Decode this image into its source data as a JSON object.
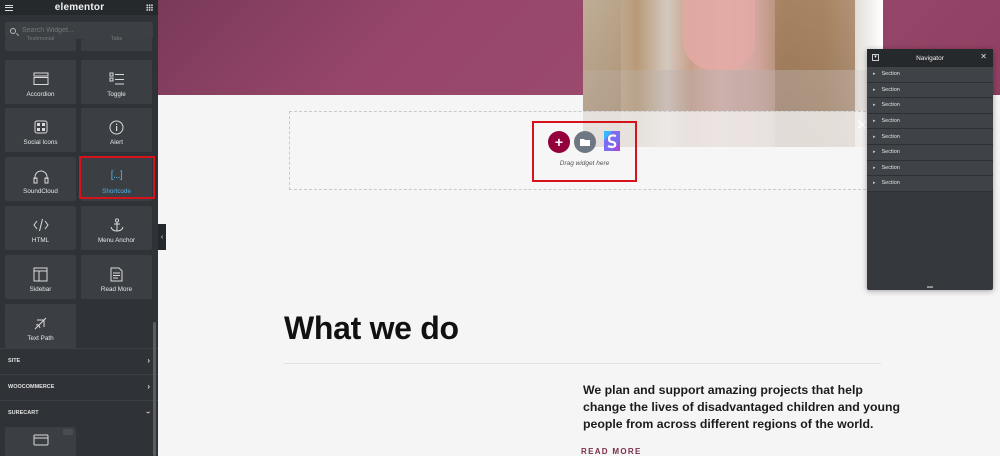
{
  "sidebar": {
    "logo": "elementor",
    "search_placeholder": "Search Widget...",
    "partial_tiles": [
      "Testimonial",
      "Tabs"
    ],
    "widgets": [
      {
        "label": "Accordion",
        "icon": "accordion-icon"
      },
      {
        "label": "Toggle",
        "icon": "toggle-icon"
      },
      {
        "label": "Social Icons",
        "icon": "social-icons-icon"
      },
      {
        "label": "Alert",
        "icon": "alert-icon"
      },
      {
        "label": "SoundCloud",
        "icon": "headphones-icon"
      },
      {
        "label": "Shortcode",
        "icon": "shortcode-icon",
        "glyph": "[...]",
        "highlighted": true
      },
      {
        "label": "HTML",
        "icon": "code-icon"
      },
      {
        "label": "Menu Anchor",
        "icon": "anchor-icon"
      },
      {
        "label": "Sidebar",
        "icon": "sidebar-icon"
      },
      {
        "label": "Read More",
        "icon": "read-more-icon"
      },
      {
        "label": "Text Path",
        "icon": "text-path-icon"
      }
    ],
    "categories": [
      {
        "label": "SITE",
        "expanded": false
      },
      {
        "label": "WOOCOMMERCE",
        "expanded": false
      },
      {
        "label": "SURECART",
        "expanded": true
      }
    ],
    "surecart_tiles": [
      {
        "icon": "card-icon"
      }
    ]
  },
  "canvas": {
    "dropzone": {
      "hint": "Drag widget here",
      "close": "✕",
      "add": "+"
    },
    "heading": "What we do",
    "paragraph": "We plan and support amazing projects that help change the lives of disadvantaged children and young people from across different regions of the world.",
    "read_more": "READ MORE"
  },
  "navigator": {
    "title": "Navigator",
    "items": [
      "Section",
      "Section",
      "Section",
      "Section",
      "Section",
      "Section",
      "Section",
      "Section"
    ]
  },
  "colors": {
    "banner": "#974669",
    "add_button": "#93003c",
    "highlight": "#d6131b",
    "active_widget": "#4fb4e8",
    "sidebar_bg": "#2f3237"
  }
}
